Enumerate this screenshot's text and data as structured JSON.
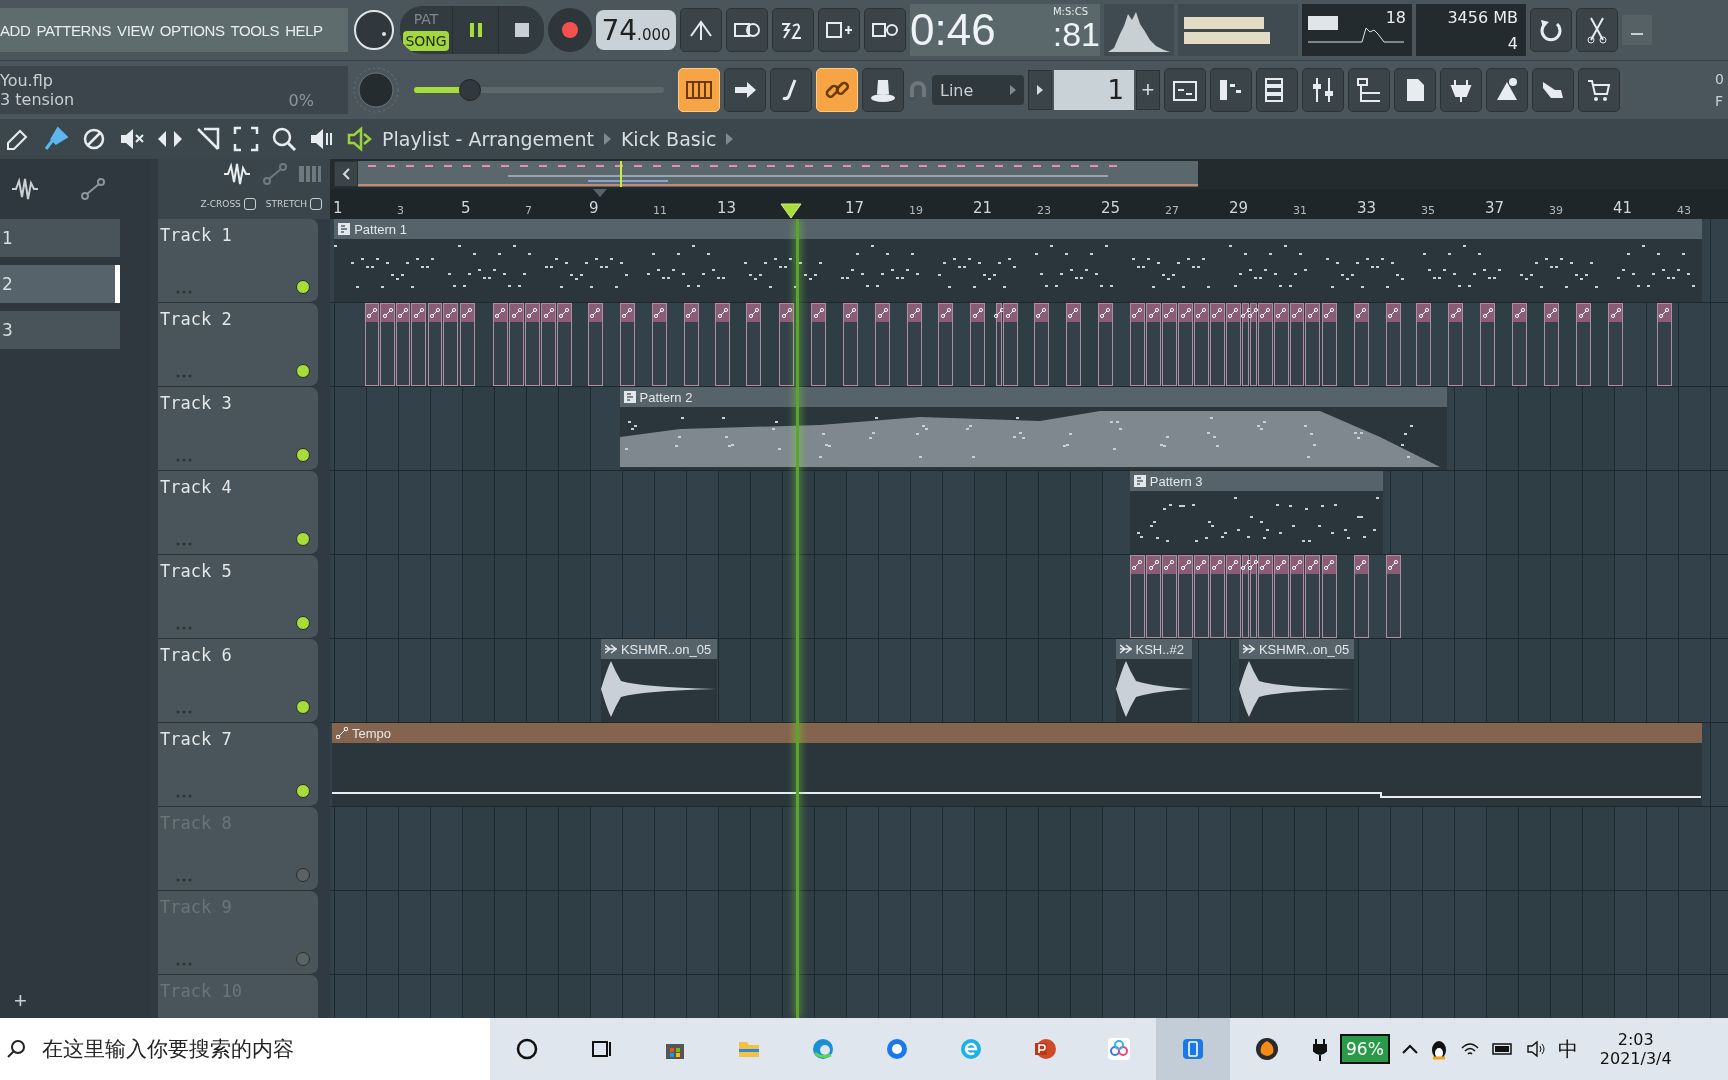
{
  "menu": [
    "ADD",
    "PATTERNS",
    "VIEW",
    "OPTIONS",
    "TOOLS",
    "HELP"
  ],
  "project": {
    "file": "You.flp",
    "hint": "3 tension",
    "percent": "0%"
  },
  "transport": {
    "modes": [
      {
        "label": "PAT",
        "selected": false
      },
      {
        "label": "SONG",
        "selected": true
      }
    ],
    "playing": true,
    "tempo": "74",
    "tempo_fraction": ".000"
  },
  "time": {
    "main": "0:46",
    "centis": ":81",
    "format": "M:S:CS"
  },
  "monitor": {
    "voices": "18",
    "memory": "3456 MB",
    "cpu": "4"
  },
  "master_volume": {
    "level": 0.22
  },
  "mode_buttons": [
    {
      "on": true
    },
    {
      "on": false
    },
    {
      "on": false
    },
    {
      "on": true
    },
    {
      "on": false
    }
  ],
  "snap": "Line",
  "pattern_number": "1",
  "pattern_add": "+",
  "breadcrumb": [
    "Playlist - Arrangement",
    "Kick Basic"
  ],
  "stretch_options": [
    {
      "label": "Z-CROSS",
      "checked": false
    },
    {
      "label": "STRETCH",
      "checked": false
    }
  ],
  "picker": [
    {
      "label": "1",
      "selected": false
    },
    {
      "label": "2",
      "selected": true
    },
    {
      "label": "3",
      "selected": false
    }
  ],
  "add_track": "+",
  "ruler": [
    "1",
    "3",
    "5",
    "7",
    "9",
    "11",
    "13",
    "17",
    "19",
    "21",
    "23",
    "25",
    "27",
    "29",
    "31",
    "33",
    "35",
    "37",
    "39",
    "41",
    "43"
  ],
  "tracks": [
    {
      "name": "Track 1",
      "active": true,
      "clips": [
        {
          "kind": "pattern",
          "label": "Pattern 1"
        }
      ]
    },
    {
      "name": "Track 2",
      "active": true,
      "clips": [
        {
          "kind": "slices"
        }
      ]
    },
    {
      "name": "Track 3",
      "active": true,
      "clips": [
        {
          "kind": "pattern",
          "label": "Pattern 2"
        }
      ]
    },
    {
      "name": "Track 4",
      "active": true,
      "clips": [
        {
          "kind": "pattern",
          "label": "Pattern 3"
        }
      ]
    },
    {
      "name": "Track 5",
      "active": true,
      "clips": [
        {
          "kind": "slices"
        }
      ]
    },
    {
      "name": "Track 6",
      "active": true,
      "clips": [
        {
          "kind": "audio",
          "label": "KSHMR..on_05"
        },
        {
          "kind": "audio",
          "label": "KSH..#2"
        },
        {
          "kind": "audio",
          "label": "KSHMR..on_05"
        }
      ]
    },
    {
      "name": "Track 7",
      "active": true,
      "clips": [
        {
          "kind": "automation",
          "label": "Tempo"
        }
      ]
    },
    {
      "name": "Track 8",
      "active": false
    },
    {
      "name": "Track 9",
      "active": false
    },
    {
      "name": "Track 10",
      "active": false
    }
  ],
  "taskbar": {
    "search_placeholder": "在这里输入你要搜索的内容",
    "battery": "96%",
    "ime": "中",
    "time": "2:03",
    "date": "2021/3/4"
  },
  "edge_labels": [
    "0",
    "F"
  ]
}
